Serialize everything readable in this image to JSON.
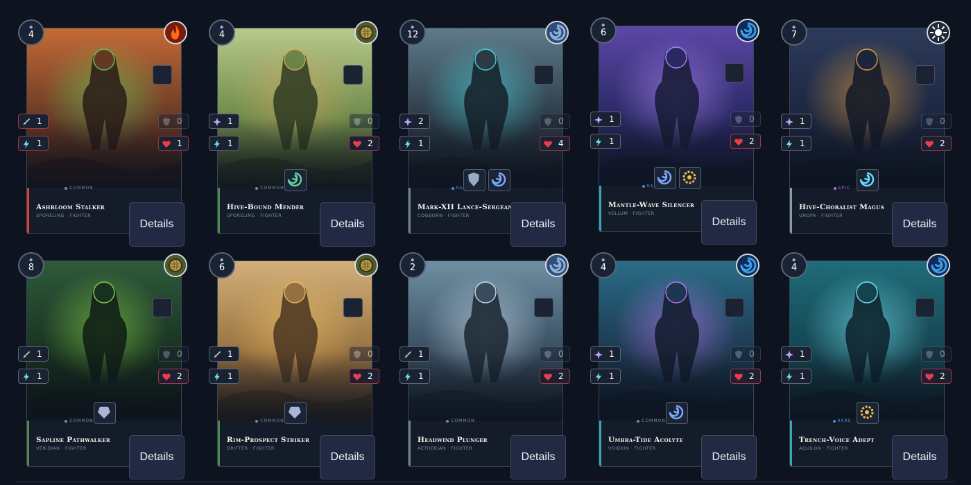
{
  "accent_colors": {
    "fire": "#d8412f",
    "earth": "#4f8a4a",
    "air": "#6d7f9a",
    "water": "#3aa6b9",
    "light": "#8c98ab"
  },
  "cards": [
    {
      "name": "Ashbloom Stalker",
      "race": "Sporeling",
      "cls": "Fighter",
      "cost": "4",
      "element": "fire",
      "rarity": "Common",
      "atk": "1",
      "def": "0",
      "spd": "1",
      "hp": "1",
      "abilities": [],
      "details": "Details",
      "art": [
        "#c46a36",
        "#6a3a26",
        "#2a1a18",
        "#5fd35a"
      ],
      "atk_icon": "sword-icon"
    },
    {
      "name": "Hive-Bound Mender",
      "race": "Sporeling",
      "cls": "Fighter",
      "cost": "4",
      "element": "earth",
      "rarity": "Common",
      "atk": "1",
      "def": "0",
      "spd": "1",
      "hp": "2",
      "abilities": [
        "spiral"
      ],
      "details": "Details",
      "art": [
        "#b9c98d",
        "#6f8b4c",
        "#2e3a22",
        "#d9a85c"
      ],
      "atk_icon": "sparkle-icon"
    },
    {
      "name": "Mark-XII Lance-Sergeant",
      "race": "Cogborn",
      "cls": "Fighter",
      "cost": "12",
      "element": "air",
      "rarity": "Rare",
      "atk": "2",
      "def": "0",
      "spd": "1",
      "hp": "4",
      "abilities": [
        "shield",
        "shard"
      ],
      "details": "Details",
      "art": [
        "#5e7b8a",
        "#2e3c48",
        "#151d26",
        "#46e0e6"
      ],
      "atk_icon": "sparkle-icon"
    },
    {
      "name": "Mantle-Wave Silencer",
      "race": "Vellum",
      "cls": "Fighter",
      "cost": "6",
      "element": "water",
      "rarity": "Rare",
      "atk": "1",
      "def": "0",
      "spd": "1",
      "hp": "2",
      "abilities": [
        "shard",
        "gear"
      ],
      "details": "Details",
      "art": [
        "#5c47a8",
        "#2c2a66",
        "#151a33",
        "#b18cff"
      ],
      "atk_icon": "sparkle-icon"
    },
    {
      "name": "Hive-Choralist Magus",
      "race": "Unopa",
      "cls": "Fighter",
      "cost": "7",
      "element": "light",
      "rarity": "Epic",
      "atk": "1",
      "def": "0",
      "spd": "1",
      "hp": "2",
      "abilities": [
        "swirl"
      ],
      "details": "Details",
      "art": [
        "#2d3b5a",
        "#1c2640",
        "#111827",
        "#f2a93a"
      ],
      "atk_icon": "sparkle-icon"
    },
    {
      "name": "Sapline Pathwalker",
      "race": "Veridian",
      "cls": "Fighter",
      "cost": "8",
      "element": "earth",
      "rarity": "Common",
      "atk": "1",
      "def": "0",
      "spd": "1",
      "hp": "2",
      "abilities": [
        "crystal"
      ],
      "details": "Details",
      "art": [
        "#2f5a3a",
        "#1a3322",
        "#0e1a14",
        "#8ee04a"
      ],
      "atk_icon": "sword-icon"
    },
    {
      "name": "Rim-Prospect Striker",
      "race": "Drifter",
      "cls": "Fighter",
      "cost": "6",
      "element": "earth",
      "rarity": "Common",
      "atk": "1",
      "def": "0",
      "spd": "1",
      "hp": "2",
      "abilities": [
        "crystal"
      ],
      "details": "Details",
      "art": [
        "#d2b07a",
        "#9a7442",
        "#4a3522",
        "#f0c060"
      ],
      "atk_icon": "sword-icon"
    },
    {
      "name": "Headwind Plunger",
      "race": "Aetherian",
      "cls": "Fighter",
      "cost": "2",
      "element": "air",
      "rarity": "Common",
      "atk": "1",
      "def": "0",
      "spd": "1",
      "hp": "2",
      "abilities": [],
      "details": "Details",
      "art": [
        "#6f8fa3",
        "#3a4f62",
        "#1a2430",
        "#cfe6f2"
      ],
      "atk_icon": "sword-icon"
    },
    {
      "name": "Umbra-Tide Acolyte",
      "race": "Voidkin",
      "cls": "Fighter",
      "cost": "4",
      "element": "water",
      "rarity": "Common",
      "atk": "1",
      "def": "0",
      "spd": "1",
      "hp": "2",
      "abilities": [
        "shard"
      ],
      "details": "Details",
      "art": [
        "#2a6c86",
        "#1d3a52",
        "#0f1a28",
        "#c27bff"
      ],
      "atk_icon": "sparkle-icon"
    },
    {
      "name": "Trench-Voice Adept",
      "race": "Aquilon",
      "cls": "Fighter",
      "cost": "4",
      "element": "water",
      "rarity": "Rare",
      "atk": "1",
      "def": "0",
      "spd": "1",
      "hp": "2",
      "abilities": [
        "gear"
      ],
      "details": "Details",
      "art": [
        "#1f6c7a",
        "#164552",
        "#0c2029",
        "#7ff2ff"
      ],
      "atk_icon": "sparkle-icon"
    }
  ]
}
